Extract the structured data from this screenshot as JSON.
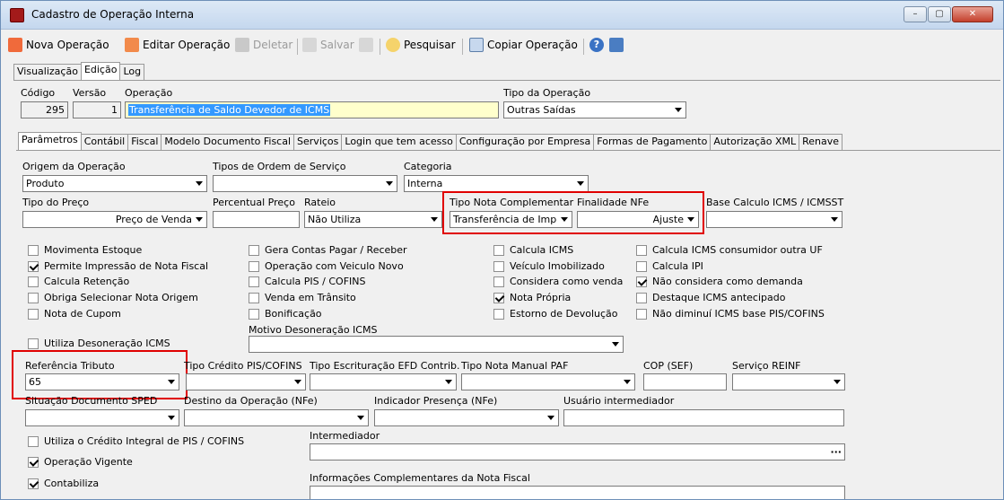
{
  "window": {
    "title": "Cadastro de Operação Interna",
    "min": "–",
    "max": "▢",
    "close": "✕"
  },
  "toolbar": {
    "nova": "Nova Operação",
    "editar": "Editar Operação",
    "deletar": "Deletar",
    "salvar": "Salvar",
    "pesquisar": "Pesquisar",
    "copiar": "Copiar Operação"
  },
  "tabs": [
    "Visualização",
    "Edição",
    "Log"
  ],
  "header": {
    "codigo_label": "Código",
    "codigo": "295",
    "versao_label": "Versão",
    "versao": "1",
    "operacao_label": "Operação",
    "operacao": "Transferência de Saldo Devedor de ICMS",
    "tipo_label": "Tipo da Operação",
    "tipo": "Outras Saídas"
  },
  "subtabs": [
    "Parâmetros",
    "Contábil",
    "Fiscal",
    "Modelo Documento Fiscal",
    "Serviços",
    "Login que tem acesso",
    "Configuração por Empresa",
    "Formas de Pagamento",
    "Autorização XML",
    "Renave"
  ],
  "fields": {
    "origem_label": "Origem da Operação",
    "origem": "Produto",
    "tipos_os_label": "Tipos de Ordem de Serviço",
    "tipos_os": "",
    "categoria_label": "Categoria",
    "categoria": "Interna",
    "tipo_preco_label": "Tipo do Preço",
    "tipo_preco": "Preço de Venda",
    "percentual_label": "Percentual Preço",
    "percentual": "",
    "rateio_label": "Rateio",
    "rateio": "Não Utiliza",
    "tipo_nota_label": "Tipo Nota Complementar",
    "tipo_nota": "Transferência de Imp",
    "finalidade_label": "Finalidade NFe",
    "finalidade": "Ajuste",
    "base_calc_label": "Base Calculo ICMS / ICMSST",
    "base_calc": "",
    "motivo_label": "Motivo Desoneração ICMS",
    "motivo": "",
    "ref_label": "Referência Tributo",
    "ref": "65",
    "credito_label": "Tipo Crédito PIS/COFINS",
    "credito": "",
    "escrit_label": "Tipo Escrituração EFD Contrib.",
    "escrit": "",
    "paf_label": "Tipo Nota Manual PAF",
    "paf": "",
    "cop_label": "COP (SEF)",
    "cop": "",
    "reinf_label": "Serviço REINF",
    "reinf": "",
    "sped_label": "Situação Documento SPED",
    "sped": "",
    "destino_label": "Destino da Operação (NFe)",
    "destino": "",
    "presenca_label": "Indicador Presença (NFe)",
    "presenca": "",
    "usuario_label": "Usuário intermediador",
    "usuario": "",
    "intermediador_label": "Intermediador",
    "intermediador": "",
    "info_label": "Informações Complementares da Nota Fiscal",
    "info": ""
  },
  "checks": [
    {
      "label": "Movimenta Estoque",
      "on": false
    },
    {
      "label": "Permite Impressão de Nota Fiscal",
      "on": true
    },
    {
      "label": "Calcula Retenção",
      "on": false
    },
    {
      "label": "Obriga Selecionar Nota Origem",
      "on": false
    },
    {
      "label": "Nota de Cupom",
      "on": false
    },
    {
      "label": "Gera Contas Pagar / Receber",
      "on": false
    },
    {
      "label": "Operação com Veiculo Novo",
      "on": false
    },
    {
      "label": "Calcula PIS / COFINS",
      "on": false
    },
    {
      "label": "Venda em Trânsito",
      "on": false
    },
    {
      "label": "Bonificação",
      "on": false
    },
    {
      "label": "Calcula ICMS",
      "on": false
    },
    {
      "label": "Veículo Imobilizado",
      "on": false
    },
    {
      "label": "Considera como venda",
      "on": false
    },
    {
      "label": "Nota Própria",
      "on": true
    },
    {
      "label": "Estorno de Devolução",
      "on": false
    },
    {
      "label": "Calcula ICMS consumidor outra UF",
      "on": false
    },
    {
      "label": "Calcula IPI",
      "on": false
    },
    {
      "label": "Não considera como demanda",
      "on": true
    },
    {
      "label": "Destaque ICMS antecipado",
      "on": false
    },
    {
      "label": "Não diminuí ICMS base PIS/COFINS",
      "on": false
    },
    {
      "label": "Utiliza Desoneração ICMS",
      "on": false
    },
    {
      "label": "Utiliza o Crédito Integral de PIS / COFINS",
      "on": false
    },
    {
      "label": "Operação Vigente",
      "on": true
    },
    {
      "label": "Contabiliza",
      "on": true
    }
  ],
  "colors": {
    "title_grad": "#c4d7ee",
    "highlight": "#e00000",
    "selection": "#3399ff"
  }
}
